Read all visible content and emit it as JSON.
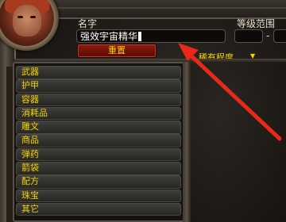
{
  "search": {
    "name_label": "名字",
    "name_value": "强效宇宙精华",
    "level_label": "等级范围",
    "level_dash": "-",
    "reset_label": "重置",
    "rarity_label": "稀有程度"
  },
  "categories": [
    "武器",
    "护甲",
    "容器",
    "消耗品",
    "雕文",
    "商品",
    "弹药",
    "箭袋",
    "配方",
    "珠宝",
    "其它"
  ],
  "colors": {
    "label_text": "#e8e0c8",
    "gold_text": "#f5d300",
    "button_red": "#8c1a10",
    "arrow_red": "#e8281a"
  },
  "icons": {
    "rarity_dropdown": "triangle-down-icon",
    "annotation": "red-arrow-icon",
    "portrait": "character-portrait"
  }
}
